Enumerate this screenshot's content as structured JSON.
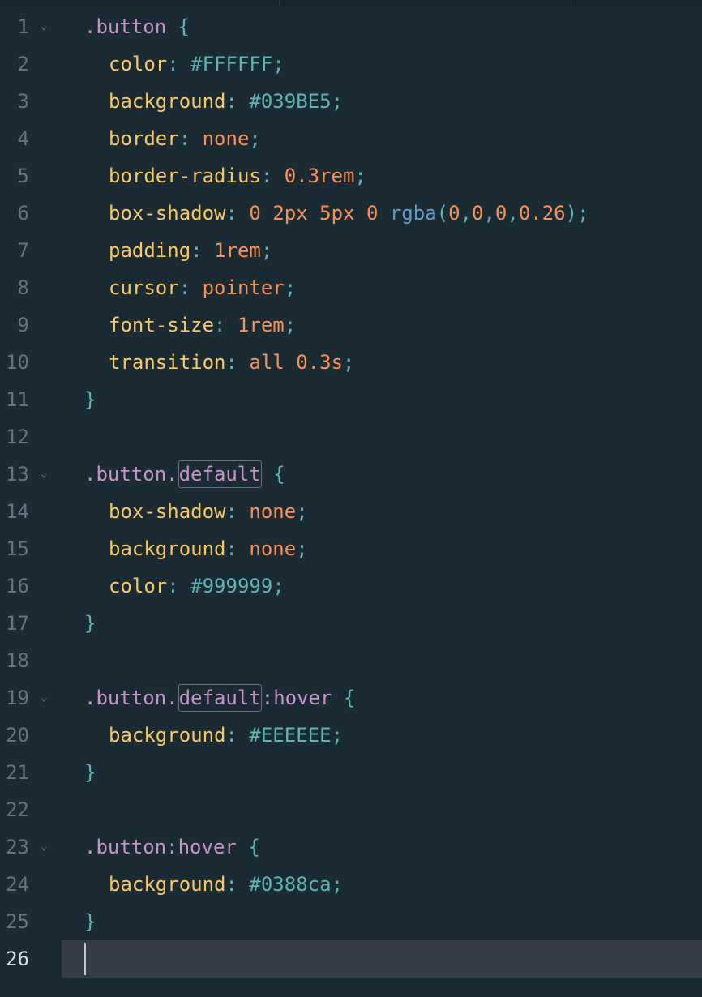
{
  "editor": {
    "current_line": 26,
    "colors": {
      "background": "#1b2b34",
      "current_line_background": "#343d46",
      "line_number": "#65737e",
      "selector": "#c594c5",
      "property": "#fac863",
      "punctuation": "#5fb3b3",
      "keyword_value": "#f99157",
      "function": "#6699cc"
    },
    "fold_icon": "chevron-down-icon",
    "lines": [
      {
        "n": "1",
        "fold": true
      },
      {
        "n": "2"
      },
      {
        "n": "3"
      },
      {
        "n": "4"
      },
      {
        "n": "5"
      },
      {
        "n": "6"
      },
      {
        "n": "7"
      },
      {
        "n": "8"
      },
      {
        "n": "9"
      },
      {
        "n": "10"
      },
      {
        "n": "11"
      },
      {
        "n": "12"
      },
      {
        "n": "13",
        "fold": true
      },
      {
        "n": "14"
      },
      {
        "n": "15"
      },
      {
        "n": "16"
      },
      {
        "n": "17"
      },
      {
        "n": "18"
      },
      {
        "n": "19",
        "fold": true
      },
      {
        "n": "20"
      },
      {
        "n": "21"
      },
      {
        "n": "22"
      },
      {
        "n": "23",
        "fold": true
      },
      {
        "n": "24"
      },
      {
        "n": "25"
      },
      {
        "n": "26"
      }
    ],
    "code": {
      "l1": {
        "sel": ".button",
        "open": "{"
      },
      "l2": {
        "prop": "color",
        "colon": ":",
        "val": "#FFFFFF",
        "semi": ";"
      },
      "l3": {
        "prop": "background",
        "colon": ":",
        "val": "#039BE5",
        "semi": ";"
      },
      "l4": {
        "prop": "border",
        "colon": ":",
        "val": "none",
        "semi": ";"
      },
      "l5": {
        "prop": "border-radius",
        "colon": ":",
        "val": "0.3rem",
        "semi": ";"
      },
      "l6": {
        "prop": "box-shadow",
        "colon": ":",
        "v1": "0",
        "v2": "2px",
        "v3": "5px",
        "v4": "0",
        "fn": "rgba",
        "lp": "(",
        "a1": "0",
        "c1": ",",
        "a2": "0",
        "c2": ",",
        "a3": "0",
        "c3": ",",
        "a4": "0.26",
        "rp": ")",
        "semi": ";"
      },
      "l7": {
        "prop": "padding",
        "colon": ":",
        "val": "1rem",
        "semi": ";"
      },
      "l8": {
        "prop": "cursor",
        "colon": ":",
        "val": "pointer",
        "semi": ";"
      },
      "l9": {
        "prop": "font-size",
        "colon": ":",
        "val": "1rem",
        "semi": ";"
      },
      "l10": {
        "prop": "transition",
        "colon": ":",
        "v1": "all",
        "v2": "0.3s",
        "semi": ";"
      },
      "l11": {
        "close": "}"
      },
      "l13": {
        "sel": ".button.",
        "match": "default",
        "open": "{"
      },
      "l14": {
        "prop": "box-shadow",
        "colon": ":",
        "val": "none",
        "semi": ";"
      },
      "l15": {
        "prop": "background",
        "colon": ":",
        "val": "none",
        "semi": ";"
      },
      "l16": {
        "prop": "color",
        "colon": ":",
        "val": "#999999",
        "semi": ";"
      },
      "l17": {
        "close": "}"
      },
      "l19": {
        "sel": ".button.",
        "match": "default",
        "pseudo": ":hover",
        "open": "{"
      },
      "l20": {
        "prop": "background",
        "colon": ":",
        "val": "#EEEEEE",
        "semi": ";"
      },
      "l21": {
        "close": "}"
      },
      "l23": {
        "sel": ".button",
        "pseudo": ":hover",
        "open": "{"
      },
      "l24": {
        "prop": "background",
        "colon": ":",
        "val": "#0388ca",
        "semi": ";"
      },
      "l25": {
        "close": "}"
      }
    }
  }
}
